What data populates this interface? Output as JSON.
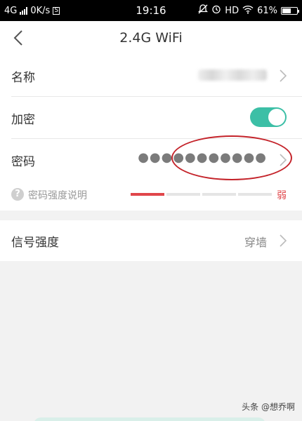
{
  "status_bar": {
    "network": "4G",
    "speed": "0K/s",
    "sim_badge": "S",
    "time": "19:16",
    "hd": "HD",
    "battery": "61%",
    "battery_level": 0.61
  },
  "header": {
    "title": "2.4G WiFi",
    "back_icon": "chevron-left-icon"
  },
  "settings": {
    "name": {
      "label": "名称",
      "value_obscured": true
    },
    "encryption": {
      "label": "加密",
      "enabled": true
    },
    "password": {
      "label": "密码",
      "value": "●●●●●●●●●●●"
    },
    "strength": {
      "help_label": "密码强度说明",
      "level_label": "弱",
      "level": 1,
      "levels_total": 4,
      "active_color": "#e0464a",
      "inactive_color": "#e5e5e5"
    },
    "signal": {
      "label": "信号强度",
      "value": "穿墙"
    }
  },
  "accent_color": "#3cbfa6",
  "watermark": "头条 @想乔啊"
}
